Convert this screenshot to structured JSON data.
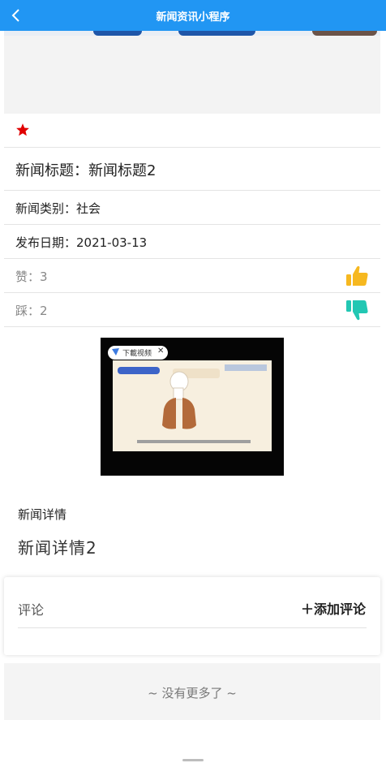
{
  "navbar": {
    "title": "新闻资讯小程序",
    "back_icon": "chevron-left-icon",
    "bg_color": "#2196f3"
  },
  "favorite": {
    "icon": "star-icon",
    "color": "#e00000"
  },
  "news": {
    "title_text": "新闻标题：新闻标题2",
    "category_text": "新闻类别：社会",
    "date_text": "发布日期：2021-03-13",
    "likes_text": "赞：3",
    "dislikes_text": "踩：2",
    "like_icon": "thumbs-up-icon",
    "like_color": "#f6b820",
    "dislike_icon": "thumbs-down-icon",
    "dislike_color": "#22c7b3"
  },
  "video": {
    "download_label": "下載视频",
    "close_label": "✕",
    "caption": ""
  },
  "detail": {
    "heading": "新闻详情",
    "body": "新闻详情2"
  },
  "comments": {
    "label": "评论",
    "add_label": "＋添加评论"
  },
  "footer": {
    "no_more": "~ 没有更多了 ~"
  }
}
